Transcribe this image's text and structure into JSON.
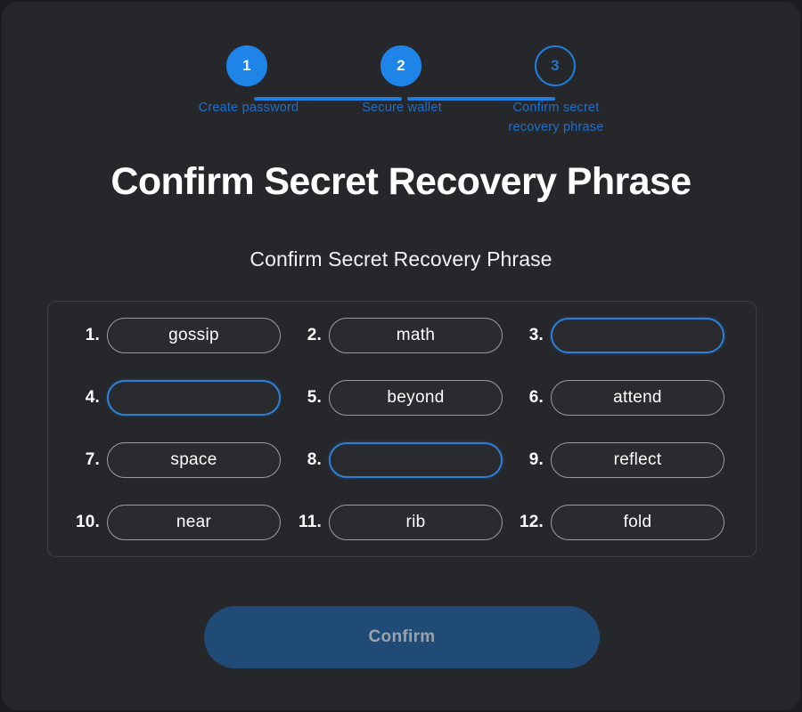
{
  "window": {
    "background_color": "#26272b",
    "page_background_color": "#1b1c1f"
  },
  "stepper": {
    "accent_color": "#1f84e8",
    "label_color": "#1e6fcb",
    "steps": [
      {
        "number": "1",
        "label": "Create password",
        "state": "done"
      },
      {
        "number": "2",
        "label": "Secure wallet",
        "state": "done"
      },
      {
        "number": "3",
        "label": "Confirm secret\nrecovery phrase",
        "label_line1": "Confirm secret",
        "label_line2": "recovery phrase",
        "state": "current"
      }
    ]
  },
  "header": {
    "title": "Confirm Secret Recovery Phrase",
    "subtitle": "Confirm Secret Recovery Phrase"
  },
  "word_grid": {
    "border_color": "#3c3e43",
    "active_border_color": "#2d7fd6",
    "inactive_border_color": "#9b9da2",
    "rows": [
      [
        {
          "index": "1.",
          "word": "gossip",
          "empty": false
        },
        {
          "index": "2.",
          "word": "math",
          "empty": false
        },
        {
          "index": "3.",
          "word": "",
          "empty": true
        }
      ],
      [
        {
          "index": "4.",
          "word": "",
          "empty": true
        },
        {
          "index": "5.",
          "word": "beyond",
          "empty": false
        },
        {
          "index": "6.",
          "word": "attend",
          "empty": false
        }
      ],
      [
        {
          "index": "7.",
          "word": "space",
          "empty": false
        },
        {
          "index": "8.",
          "word": "",
          "empty": true
        },
        {
          "index": "9.",
          "word": "reflect",
          "empty": false
        }
      ],
      [
        {
          "index": "10.",
          "word": "near",
          "empty": false
        },
        {
          "index": "11.",
          "word": "rib",
          "empty": false
        },
        {
          "index": "12.",
          "word": "fold",
          "empty": false
        }
      ]
    ]
  },
  "footer": {
    "confirm_label": "Confirm",
    "confirm_disabled": true,
    "confirm_color": "#1f4b76",
    "confirm_text_color": "#9aa3ad"
  }
}
